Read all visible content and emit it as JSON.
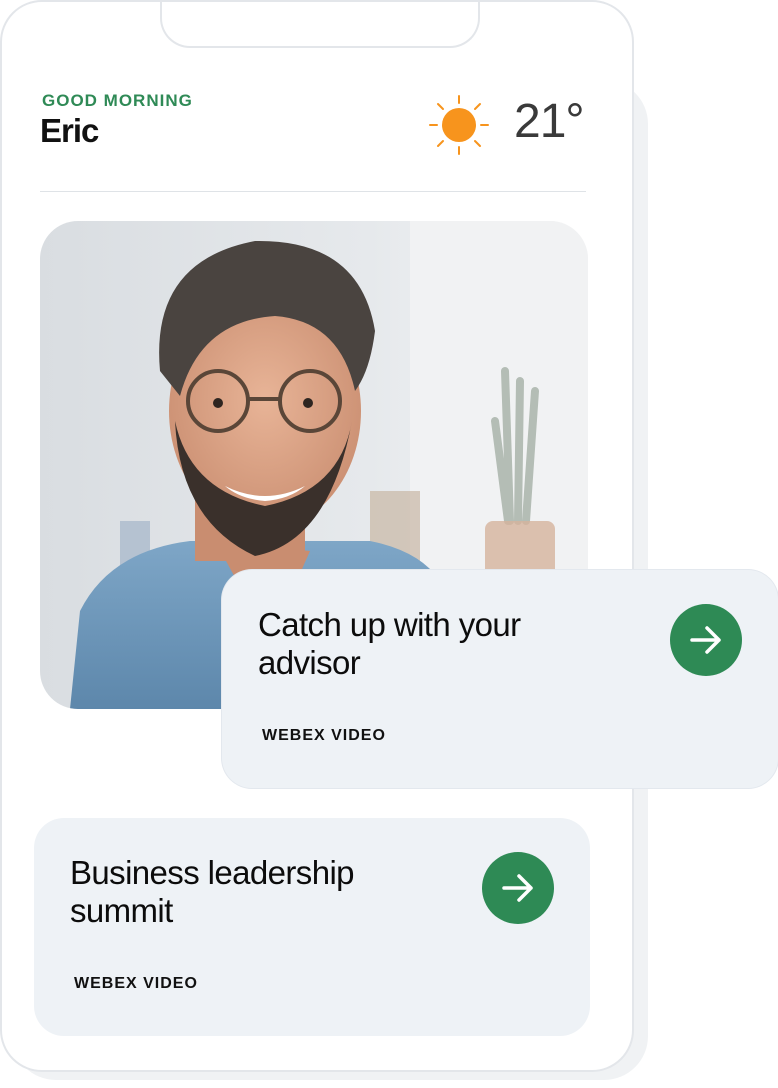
{
  "header": {
    "greeting": "GOOD MORNING",
    "user_name": "Eric",
    "weather_icon": "sun-icon",
    "temperature": "21°"
  },
  "photo": {
    "subject": "advisor-photo"
  },
  "cards": [
    {
      "title": "Catch up with your advisor",
      "label": "WEBEX VIDEO",
      "action_icon": "arrow-right-icon"
    },
    {
      "title": "Business leadership summit",
      "label": "WEBEX VIDEO",
      "action_icon": "arrow-right-icon"
    }
  ],
  "colors": {
    "accent_green": "#2e8a55",
    "greeting_green": "#2f8a56",
    "sun_orange": "#f7941d",
    "card_bg": "#eef2f6"
  }
}
